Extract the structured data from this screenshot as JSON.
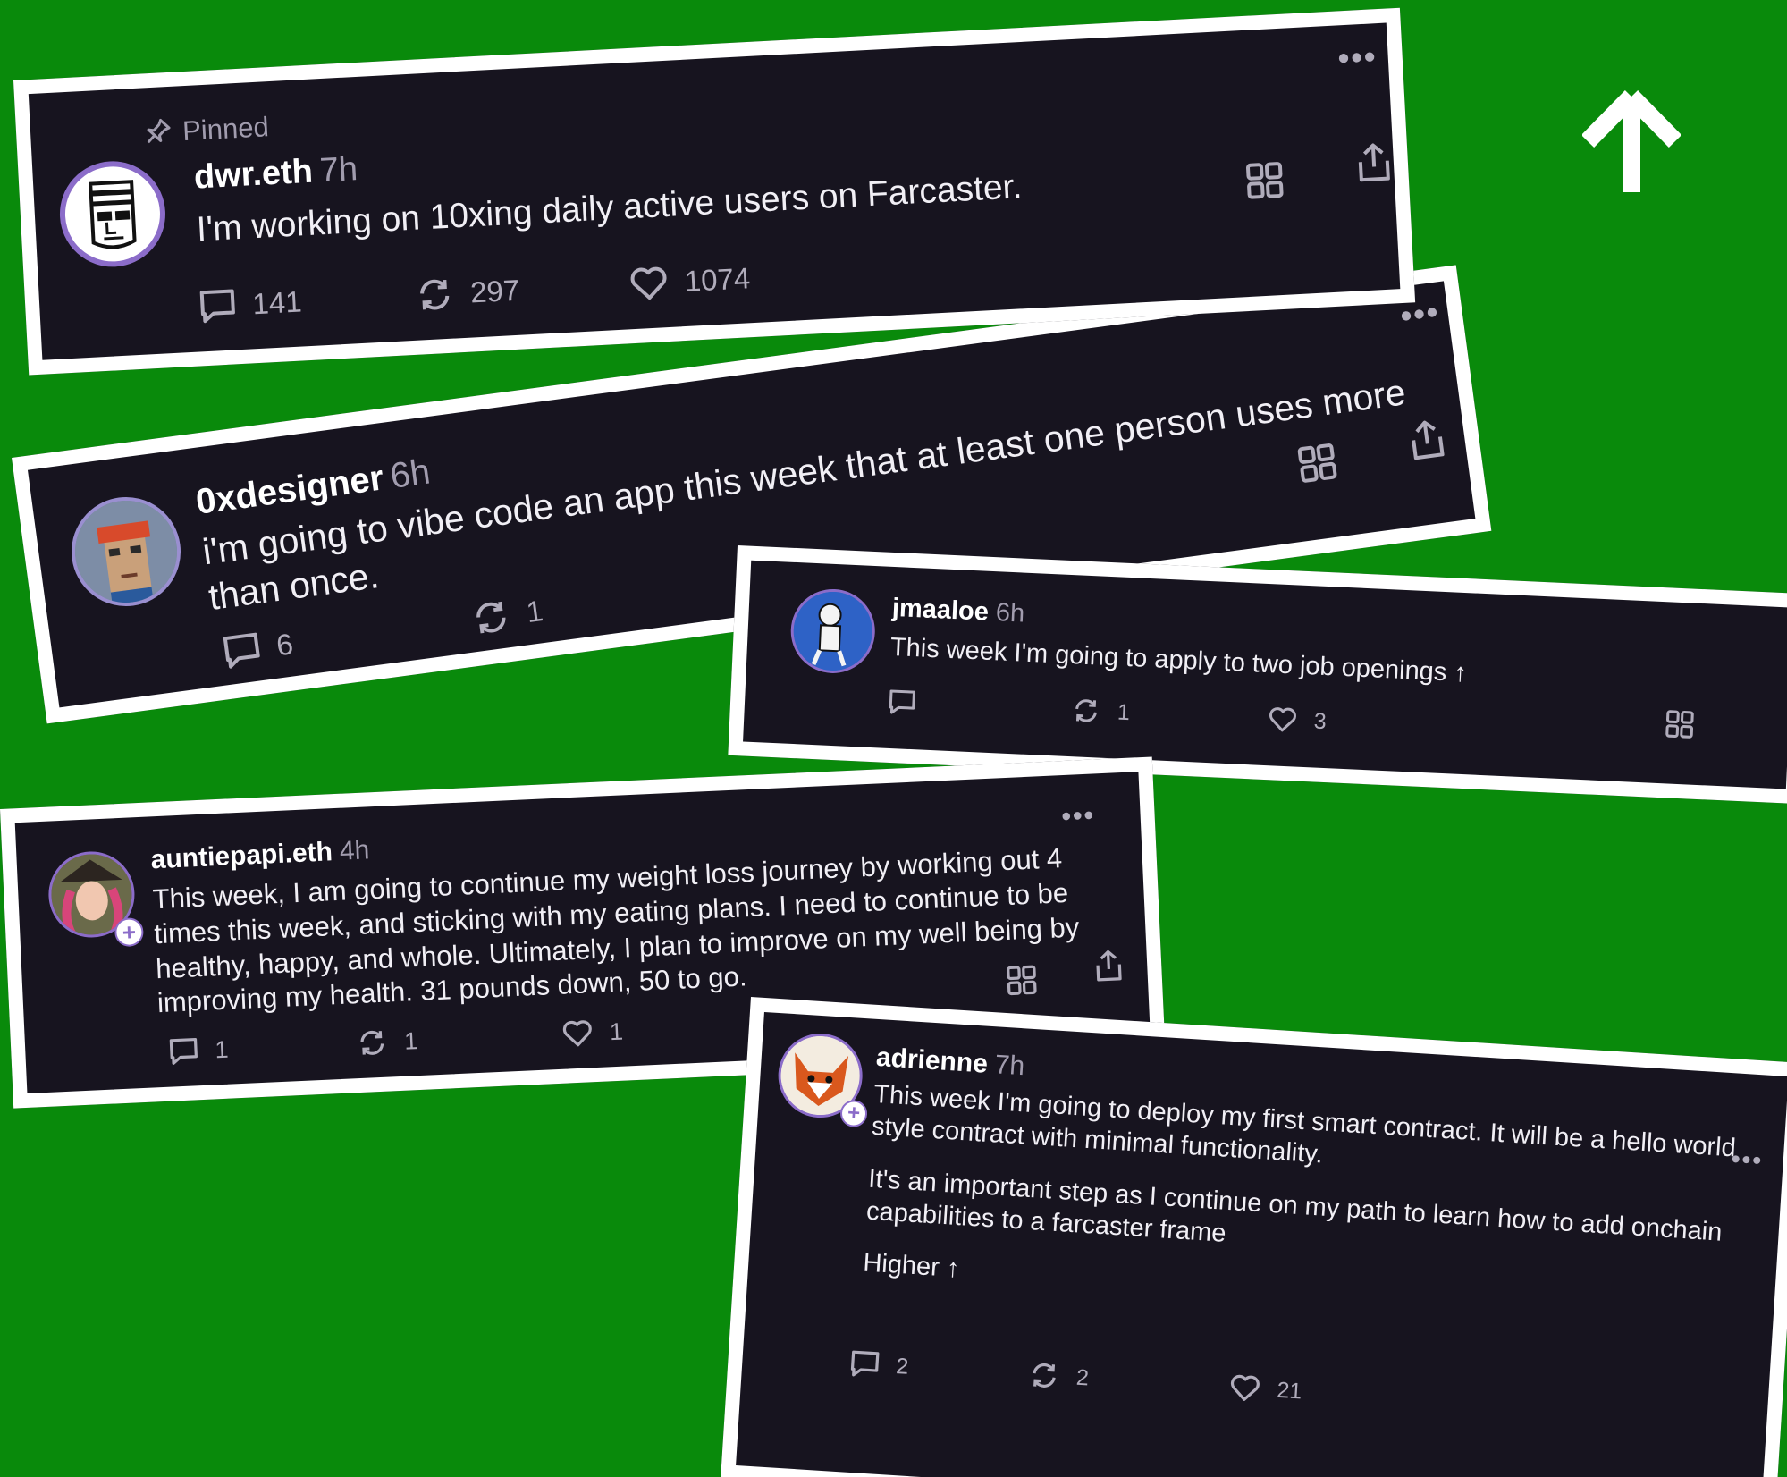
{
  "colors": {
    "background": "#098a0b",
    "card": "#17141f",
    "frame": "#ffffff",
    "muted": "#a19cae",
    "accent": "#8b6cc9"
  },
  "decor": {
    "icon": "up-arrow-icon"
  },
  "posts": [
    {
      "pinned_label": "Pinned",
      "handle": "dwr.eth",
      "time": "7h",
      "text": [
        "I'm working on 10xing daily active users on Farcaster."
      ],
      "replies": "141",
      "recasts": "297",
      "likes": "1074"
    },
    {
      "handle": "0xdesigner",
      "time": "6h",
      "text": [
        "i'm going to vibe code an app this week that at least one person uses more than once."
      ],
      "replies": "6",
      "recasts": "1",
      "likes": ""
    },
    {
      "handle": "jmaaloe",
      "time": "6h",
      "text": [
        "This week I'm going to apply to two job openings ↑"
      ],
      "replies": "",
      "recasts": "1",
      "likes": "3"
    },
    {
      "handle": "auntiepapi.eth",
      "time": "4h",
      "text": [
        "This week, I am going to continue my weight loss journey by working out 4 times this week, and sticking with my eating plans. I need to continue to be healthy, happy, and whole. Ultimately, I plan to improve on my well being by improving my health.  31 pounds down,  50 to go."
      ],
      "replies": "1",
      "recasts": "1",
      "likes": "1"
    },
    {
      "handle": "adrienne",
      "time": "7h",
      "text": [
        "This week I'm going to deploy my first smart contract. It will be a hello world style contract with minimal functionality.",
        "It's an important step as I continue on my path to learn how to add onchain capabilities to a farcaster frame",
        "Higher ↑"
      ],
      "replies": "2",
      "recasts": "2",
      "likes": "21"
    }
  ]
}
